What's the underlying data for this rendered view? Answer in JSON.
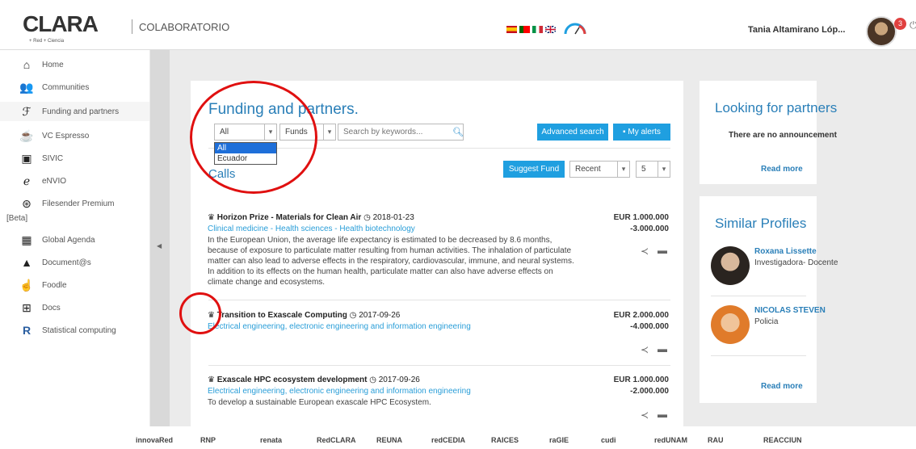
{
  "header": {
    "logo_text": "CLARA",
    "logo_sub": "+ Red + Ciencia",
    "section": "COLABORATORIO",
    "user_name": "Tania Altamirano Lóp...",
    "notification_count": "3",
    "flags": [
      "es-flag",
      "pt-flag",
      "it-flag",
      "uk-flag"
    ]
  },
  "sidebar": {
    "items": [
      {
        "label": "Home",
        "icon": "home-icon"
      },
      {
        "label": "Communities",
        "icon": "communities-icon"
      },
      {
        "label": "Funding and partners",
        "icon": "funding-icon"
      },
      {
        "label": "VC Espresso",
        "icon": "vc-espresso-icon"
      },
      {
        "label": "SIVIC",
        "icon": "sivic-icon"
      },
      {
        "label": "eNVIO",
        "icon": "envio-icon"
      },
      {
        "label": "Filesender Premium",
        "label2": "[Beta]",
        "icon": "filesender-icon"
      },
      {
        "label": "Global Agenda",
        "icon": "agenda-icon"
      },
      {
        "label": "Document@s",
        "icon": "documents-icon"
      },
      {
        "label": "Foodle",
        "icon": "foodle-icon"
      },
      {
        "label": "Docs",
        "icon": "docs-icon"
      },
      {
        "label": "Statistical computing",
        "icon": "r-icon"
      }
    ]
  },
  "funding": {
    "title": "Funding and partners.",
    "country_select": "All",
    "country_options": [
      "All",
      "Ecuador"
    ],
    "type_select": "Funds",
    "search_placeholder": "Search by keywords...",
    "advanced_search": "Advanced search",
    "my_alerts": "My alerts",
    "calls_heading": "Calls",
    "suggest_fund": "Suggest Fund",
    "sort_select": "Recent",
    "page_size_select": "5"
  },
  "calls": [
    {
      "title": "Horizon Prize - Materials for Clean Air",
      "date": "2018-01-23",
      "category": "Clinical medicine - Health sciences - Health biotechnology",
      "desc": "In the European Union, the average life expectancy is estimated to be decreased by 8.6 months, because of exposure to particulate matter resulting from human activities. The inhalation of particulate matter can also lead to adverse effects in the respiratory, cardiovascular, immune, and neural systems. In addition to its effects on the human health, particulate matter can also have adverse effects on climate change and ecosystems.",
      "amount_min": "EUR 1.000.000",
      "amount_max": "-3.000.000"
    },
    {
      "title": "Transition to Exascale Computing",
      "date": "2017-09-26",
      "category": "Electrical engineering, electronic engineering and information engineering",
      "desc": "",
      "amount_min": "EUR 2.000.000",
      "amount_max": "-4.000.000"
    },
    {
      "title": "Exascale HPC ecosystem development",
      "date": "2017-09-26",
      "category": "Electrical engineering, electronic engineering and information engineering",
      "desc": "To develop a sustainable European exascale HPC Ecosystem.",
      "amount_min": "EUR 1.000.000",
      "amount_max": "-2.000.000"
    }
  ],
  "looking": {
    "title": "Looking for partners",
    "message": "There are no announcement",
    "link": "Read more"
  },
  "similar": {
    "title": "Similar Profiles",
    "profiles": [
      {
        "name": "Roxana Lissette",
        "role": "Investigadora- Docente"
      },
      {
        "name": "NICOLAS STEVEN",
        "role": "Policia"
      }
    ],
    "link": "Read more"
  },
  "footer": {
    "logos": [
      "innovaRed",
      "RNP",
      "renata",
      "RedCLARA",
      "REUNA",
      "redCEDIA",
      "RAICES",
      "raGIE",
      "cudi",
      "redUNAM",
      "RAU",
      "REACCIUN"
    ]
  },
  "colors": {
    "accent": "#2a7fb8",
    "button": "#1f9fe0",
    "annotation": "#e01010"
  }
}
